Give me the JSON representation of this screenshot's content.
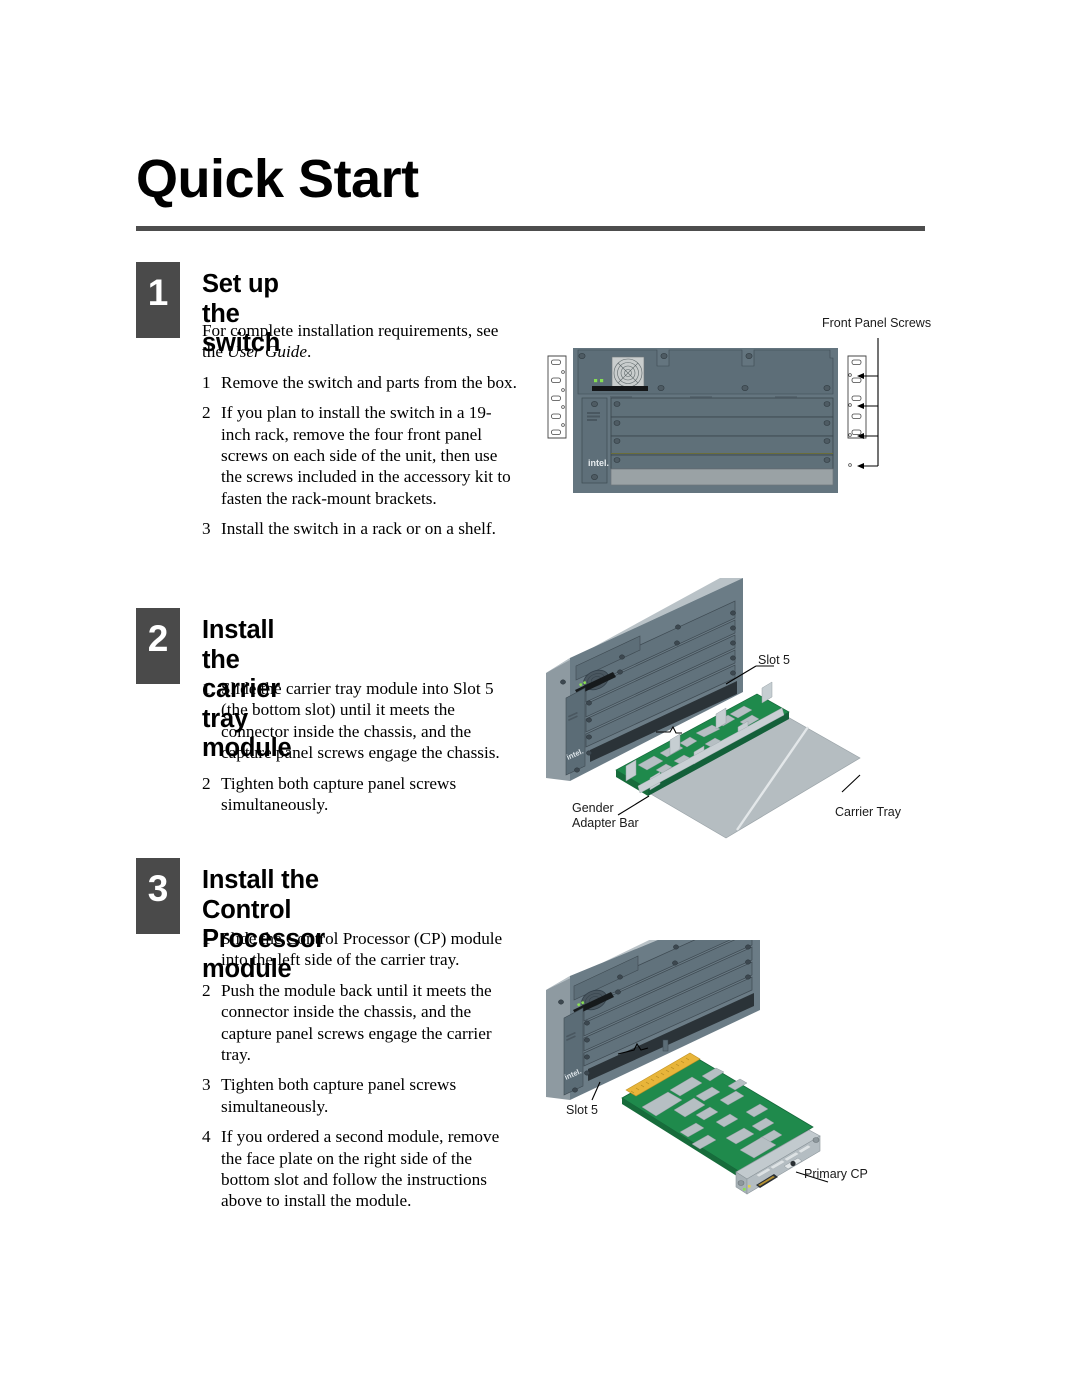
{
  "document": {
    "title": "Quick Start"
  },
  "steps": [
    {
      "number": "1",
      "heading": "Set up the switch",
      "intro_before": "For complete installation requirements, see the ",
      "intro_italic": "User Guide",
      "intro_after": ".",
      "items": [
        {
          "num": "1",
          "text": "Remove the switch and parts from the box."
        },
        {
          "num": "2",
          "text": "If you plan to install the switch in a 19-inch rack, remove the four front panel screws on each side of the unit, then use the screws included in the accessory kit to fasten the rack-mount brackets."
        },
        {
          "num": "3",
          "text": "Install the switch in a rack or on a shelf."
        }
      ]
    },
    {
      "number": "2",
      "heading": "Install the carrier\ntray module",
      "items": [
        {
          "num": "1",
          "text": "Slide the carrier tray module into Slot 5 (the bottom slot) until it meets the connector inside the chassis, and the capture panel screws engage the chassis."
        },
        {
          "num": "2",
          "text": "Tighten both capture panel screws simultaneously."
        }
      ]
    },
    {
      "number": "3",
      "heading": "Install the Control\nProcessor module",
      "items": [
        {
          "num": "1",
          "text": "Slide the Control Processor (CP) module into the left side of the carrier tray."
        },
        {
          "num": "2",
          "text": "Push the module back until it meets the connector inside the chassis, and the capture panel screws engage the carrier tray."
        },
        {
          "num": "3",
          "text": "Tighten both capture panel screws simultaneously."
        },
        {
          "num": "4",
          "text": "If you ordered a second module, remove the face plate on the right side of the bottom slot and follow the instructions above to install the module."
        }
      ]
    }
  ],
  "illustrations": {
    "figure1": {
      "name": "switch-front-panel",
      "labels": {
        "front_panel_screws": "Front Panel Screws"
      },
      "brand": "intel."
    },
    "figure2": {
      "name": "carrier-tray-module",
      "labels": {
        "slot5": "Slot 5",
        "gender_adapter_bar": "Gender\nAdapter Bar",
        "carrier_tray": "Carrier Tray"
      },
      "brand": "intel."
    },
    "figure3": {
      "name": "control-processor-module",
      "labels": {
        "slot5": "Slot 5",
        "primary_cp": "Primary CP"
      },
      "brand": "intel."
    }
  },
  "colors": {
    "badge_bg": "#4a4a4a",
    "rule": "#4d4d4d",
    "chassis_face": "#6b7b85",
    "chassis_dark": "#52626c",
    "bezel": "#5f7079",
    "pcb_green": "#1f8a4c",
    "pcb_green_dark": "#156b3a",
    "metal_light": "#c3cacd",
    "metal_mid": "#9aa5ab",
    "gold": "#e8b53a",
    "led_green": "#7ddc4a"
  }
}
